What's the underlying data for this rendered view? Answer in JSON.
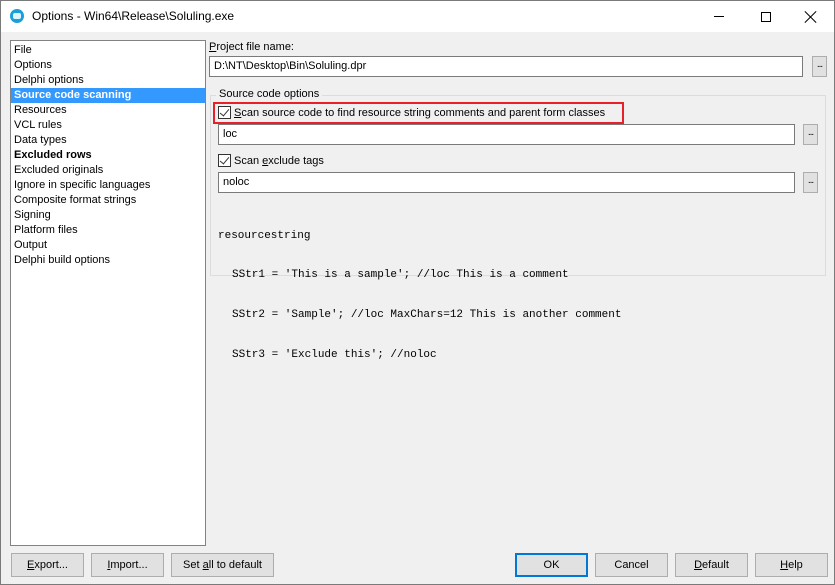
{
  "window": {
    "title": "Options - Win64\\Release\\Soluling.exe",
    "controls": {
      "minimize": "minimize",
      "maximize": "maximize",
      "close": "close"
    }
  },
  "nav": {
    "items": [
      {
        "label": "File",
        "bold": false,
        "selected": false
      },
      {
        "label": "Options",
        "bold": false,
        "selected": false
      },
      {
        "label": "Delphi options",
        "bold": false,
        "selected": false
      },
      {
        "label": "Source code scanning",
        "bold": true,
        "selected": true
      },
      {
        "label": "Resources",
        "bold": false,
        "selected": false
      },
      {
        "label": "VCL rules",
        "bold": false,
        "selected": false
      },
      {
        "label": "Data types",
        "bold": false,
        "selected": false
      },
      {
        "label": "Excluded rows",
        "bold": true,
        "selected": false
      },
      {
        "label": "Excluded originals",
        "bold": false,
        "selected": false
      },
      {
        "label": "Ignore in specific languages",
        "bold": false,
        "selected": false
      },
      {
        "label": "Composite format strings",
        "bold": false,
        "selected": false
      },
      {
        "label": "Signing",
        "bold": false,
        "selected": false
      },
      {
        "label": "Platform files",
        "bold": false,
        "selected": false
      },
      {
        "label": "Output",
        "bold": false,
        "selected": false
      },
      {
        "label": "Delphi build options",
        "bold": false,
        "selected": false
      }
    ]
  },
  "project": {
    "label_accel": "P",
    "label_rest": "roject file name:",
    "value": "D:\\NT\\Desktop\\Bin\\Soluling.dpr",
    "browse_label": "..."
  },
  "source_options": {
    "group_title": "Source code options",
    "scan_checkbox": {
      "checked": true,
      "label_accel": "S",
      "label_rest": "can source code to find resource string comments and parent form classes",
      "highlighted": true,
      "highlight_color": "#e8202a"
    },
    "scan_tag": {
      "value": "loc",
      "browse_label": "..."
    },
    "exclude_checkbox": {
      "checked": true,
      "label_pre": "Scan ",
      "label_accel": "e",
      "label_rest": "xclude tags"
    },
    "exclude_tag": {
      "value": "noloc",
      "browse_label": "..."
    },
    "code_sample": [
      "resourcestring",
      "SStr1 = 'This is a sample'; //loc This is a comment",
      "SStr2 = 'Sample'; //loc MaxChars=12 This is another comment",
      "SStr3 = 'Exclude this'; //noloc"
    ]
  },
  "footer": {
    "export": {
      "accel": "E",
      "rest": "xport..."
    },
    "import": {
      "accel": "I",
      "rest": "mport..."
    },
    "set_default": {
      "pre": "Set ",
      "accel": "a",
      "rest": "ll to default"
    },
    "ok": "OK",
    "cancel": "Cancel",
    "default": {
      "accel": "D",
      "rest": "efault"
    },
    "help": {
      "accel": "H",
      "rest": "elp"
    }
  },
  "colors": {
    "selection": "#3399ff",
    "highlight_border": "#e8202a",
    "default_button_border": "#0078d7",
    "app_icon": "#1aa0d8"
  }
}
